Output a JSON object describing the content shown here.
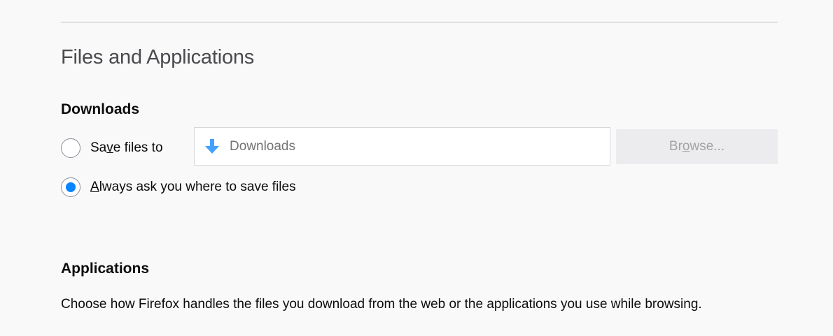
{
  "section": {
    "title": "Files and Applications"
  },
  "downloads": {
    "heading": "Downloads",
    "save_option": {
      "label_before": "Sa",
      "label_access": "v",
      "label_after": "e files to",
      "checked": false
    },
    "path_field": {
      "icon": "download-arrow-icon",
      "value": "Downloads"
    },
    "browse_button": {
      "label_before": "Br",
      "label_access": "o",
      "label_after": "wse..."
    },
    "ask_option": {
      "label_access": "A",
      "label_after": "lways ask you where to save files",
      "checked": true
    }
  },
  "applications": {
    "heading": "Applications",
    "description": "Choose how Firefox handles the files you download from the web or the applications you use while browsing."
  },
  "colors": {
    "accent": "#0a84ff",
    "download_icon": "#45a1ff",
    "background": "#f9f9f9"
  }
}
